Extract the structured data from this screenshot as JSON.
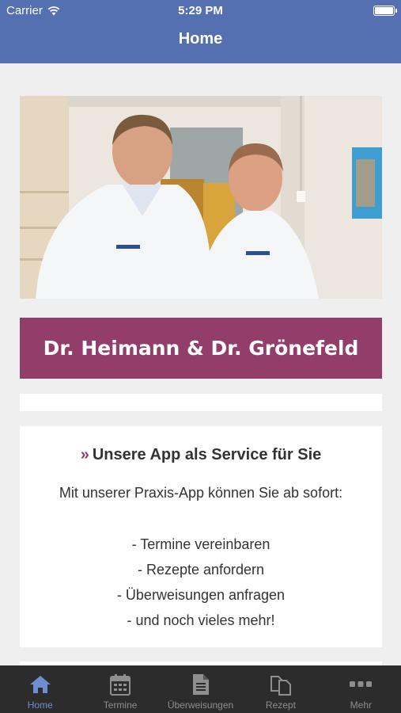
{
  "status_bar": {
    "carrier": "Carrier",
    "time": "5:29 PM"
  },
  "nav": {
    "title": "Home"
  },
  "banner": {
    "title": "Dr. Heimann & Dr. Grönefeld"
  },
  "service": {
    "quote_mark": "»",
    "heading": "Unsere App als Service für Sie",
    "intro": "Mit unserer Praxis-App können Sie ab sofort:",
    "items": [
      "- Termine vereinbaren",
      "- Rezepte anfordern",
      "- Überweisungen anfragen",
      "- und noch vieles mehr!"
    ]
  },
  "tabs": [
    {
      "label": "Home",
      "icon": "home-icon",
      "active": true
    },
    {
      "label": "Termine",
      "icon": "calendar-icon",
      "active": false
    },
    {
      "label": "Überweisungen",
      "icon": "document-icon",
      "active": false
    },
    {
      "label": "Rezept",
      "icon": "copy-icon",
      "active": false
    },
    {
      "label": "Mehr",
      "icon": "more-icon",
      "active": false
    }
  ],
  "colors": {
    "nav": "#5570b0",
    "banner": "#933d6a",
    "tab_active": "#6f8ed0",
    "tab_bar": "#2c2c2c"
  }
}
